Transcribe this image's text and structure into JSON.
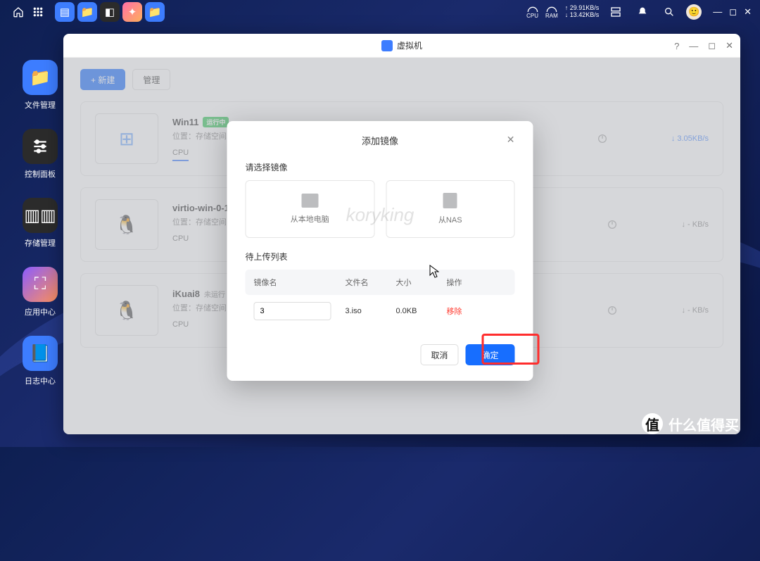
{
  "topbar": {
    "cpu_label": "CPU",
    "ram_label": "RAM",
    "net_up": "↑ 29.91KB/s",
    "net_down": "↓ 13.42KB/s"
  },
  "leftdock": {
    "items": [
      {
        "label": "文件管理",
        "ic": "folder"
      },
      {
        "label": "控制面板",
        "ic": "sliders"
      },
      {
        "label": "存储管理",
        "ic": "hdd"
      },
      {
        "label": "应用中心",
        "ic": "puzzle"
      },
      {
        "label": "日志中心",
        "ic": "book"
      }
    ]
  },
  "window": {
    "title": "虚拟机",
    "new_btn": "+  新建",
    "manage_btn": "管理"
  },
  "vms": [
    {
      "name": "Win11",
      "running": true,
      "status_text": "运行中",
      "loc": "位置：存储空间7",
      "cpu": "CPU",
      "speed": "↓ 3.05KB/s",
      "icon": "win"
    },
    {
      "name": "virtio-win-0-1-24",
      "running": false,
      "status_text": "",
      "loc": "位置：存储空间7",
      "cpu": "CPU",
      "speed": "↓ - KB/s",
      "icon": "linux"
    },
    {
      "name": "iKuai8",
      "running": false,
      "status_text": "未运行",
      "loc": "位置：存储空间7",
      "cpu": "CPU",
      "speed": "↓ - KB/s",
      "icon": "linux"
    }
  ],
  "modal": {
    "title": "添加镜像",
    "sec_source": "请选择镜像",
    "src_local": "从本地电脑",
    "src_nas": "从NAS",
    "sec_queue": "待上传列表",
    "col_name": "镜像名",
    "col_file": "文件名",
    "col_size": "大小",
    "col_op": "操作",
    "row": {
      "name_input": "3",
      "file": "3.iso",
      "size": "0.0KB",
      "op": "移除"
    },
    "cancel": "取消",
    "confirm": "确定",
    "watermark": "koryking"
  },
  "brand": "什么值得买"
}
